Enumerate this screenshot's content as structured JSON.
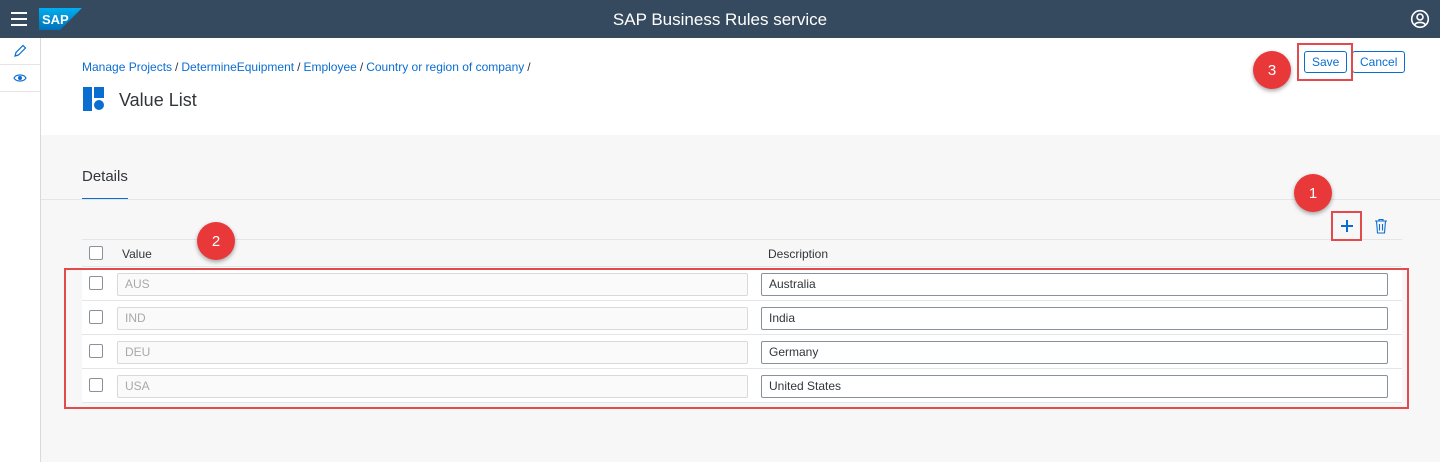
{
  "shell": {
    "title": "SAP Business Rules service",
    "logo_text": "SAP",
    "menu_icon": "hamburger-icon",
    "user_icon": "user-profile-icon",
    "brand_color": "#354a5f"
  },
  "side_toolbar": {
    "items": [
      {
        "icon": "edit-pencil-icon"
      },
      {
        "icon": "preview-eye-icon"
      }
    ]
  },
  "breadcrumb": {
    "items": [
      "Manage Projects",
      "DetermineEquipment",
      "Employee",
      "Country or region of company"
    ],
    "separator": "/"
  },
  "page": {
    "title": "Value List",
    "title_icon": "value-list-icon"
  },
  "actions": {
    "save_label": "Save",
    "cancel_label": "Cancel"
  },
  "tabs": {
    "details_label": "Details"
  },
  "table_toolbar": {
    "add_icon": "add-plus-icon",
    "delete_icon": "delete-trash-icon"
  },
  "table": {
    "columns": [
      "Value",
      "Description"
    ],
    "rows": [
      {
        "value": "AUS",
        "description": "Australia"
      },
      {
        "value": "IND",
        "description": "India"
      },
      {
        "value": "DEU",
        "description": "Germany"
      },
      {
        "value": "USA",
        "description": "United States"
      }
    ]
  },
  "callouts": [
    "1",
    "2",
    "3"
  ],
  "colors": {
    "accent": "#0a6ed1",
    "callout": "#e8383a"
  }
}
